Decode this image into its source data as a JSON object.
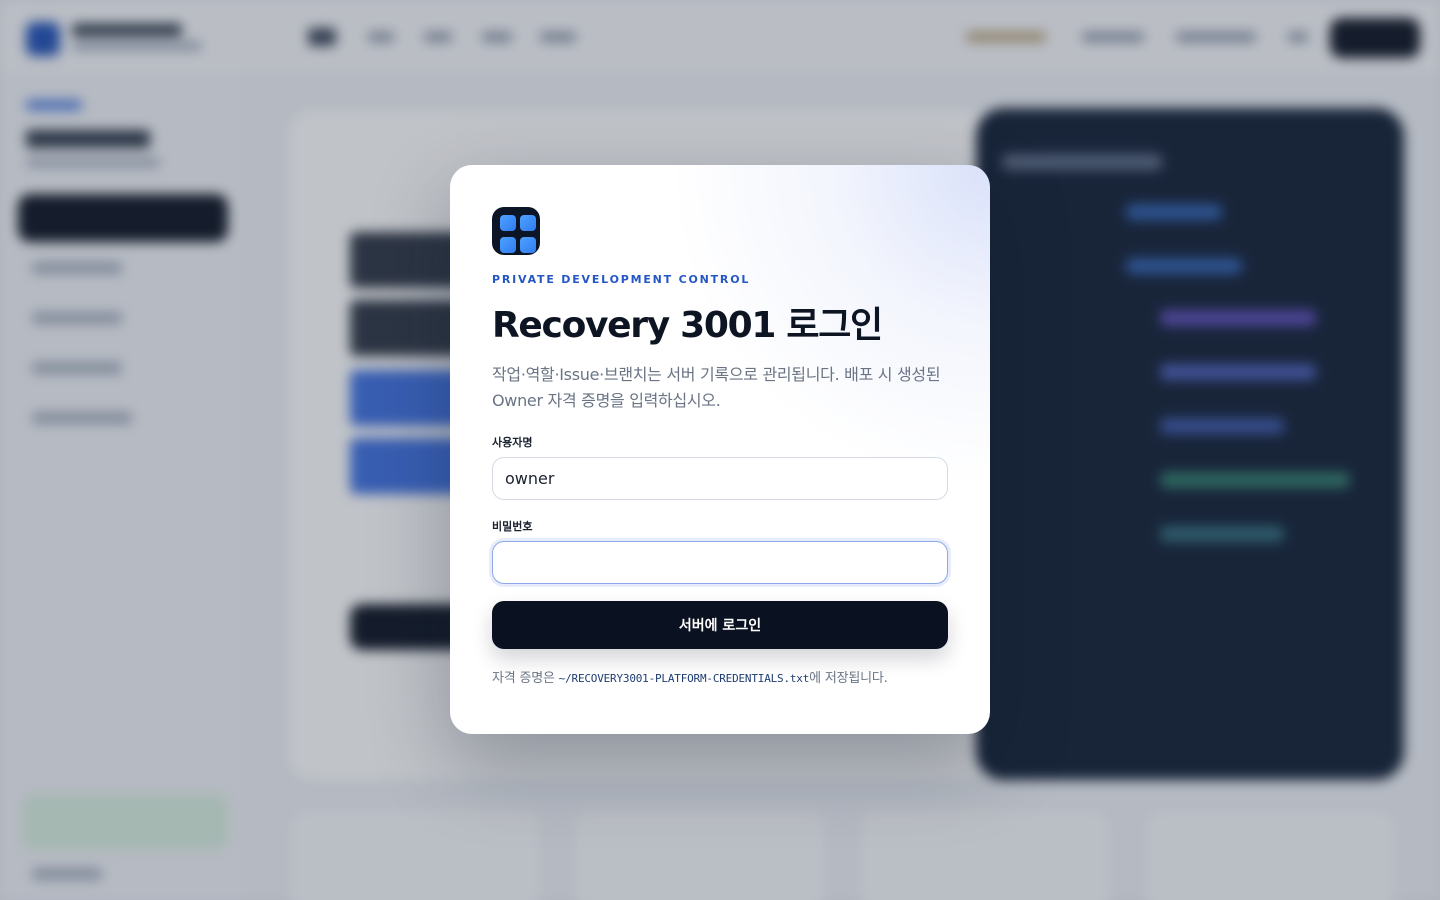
{
  "login": {
    "eyebrow": "PRIVATE DEVELOPMENT CONTROL",
    "title": "Recovery 3001 로그인",
    "description": "작업·역할·Issue·브랜치는 서버 기록으로 관리됩니다. 배포 시 생성된 Owner 자격 증명을 입력하십시오.",
    "username": {
      "label": "사용자명",
      "value": "owner"
    },
    "password": {
      "label": "비밀번호",
      "value": ""
    },
    "submit_label": "서버에 로그인",
    "note": {
      "prefix": "자격 증명은 ",
      "path": "~/RECOVERY3001-PLATFORM-CREDENTIALS.txt",
      "suffix": "에 저장됩니다."
    },
    "app_icon": "grid-app-icon"
  },
  "colors": {
    "accent": "#2457c5",
    "button": "#0a1120",
    "icon_tile": "#3b8ef8"
  }
}
